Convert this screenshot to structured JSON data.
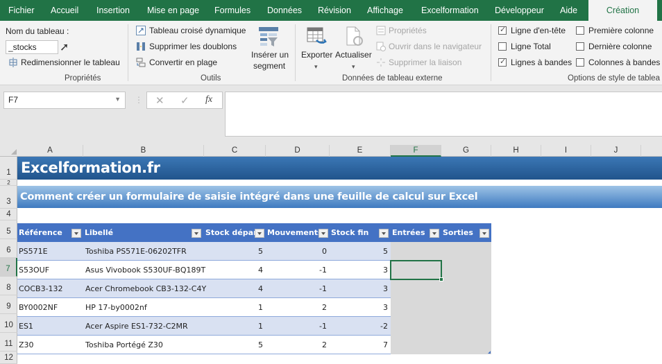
{
  "menu": {
    "tabs": [
      "Fichier",
      "Accueil",
      "Insertion",
      "Mise en page",
      "Formules",
      "Données",
      "Révision",
      "Affichage",
      "Excelformation",
      "Développeur",
      "Aide",
      "Création"
    ],
    "active_tab": "Création"
  },
  "ribbon": {
    "proprietes": {
      "name_label": "Nom du tableau :",
      "name_value": "_stocks",
      "resize_label": "Redimensionner le tableau",
      "group_label": "Propriétés"
    },
    "outils": {
      "pivot_label": "Tableau croisé dynamique",
      "remove_dup_label": "Supprimer les doublons",
      "convert_label": "Convertir en plage",
      "slicer_label_1": "Insérer un",
      "slicer_label_2": "segment",
      "group_label": "Outils"
    },
    "external": {
      "export_label": "Exporter",
      "refresh_label": "Actualiser",
      "properties_label": "Propriétés",
      "open_browser_label": "Ouvrir dans le navigateur",
      "unlink_label": "Supprimer la liaison",
      "group_label": "Données de tableau externe"
    },
    "style_options": {
      "header_row": {
        "label": "Ligne d'en-tête",
        "checked": true
      },
      "total_row": {
        "label": "Ligne Total",
        "checked": false
      },
      "banded_rows": {
        "label": "Lignes à bandes",
        "checked": true
      },
      "first_col": {
        "label": "Première colonne",
        "checked": false
      },
      "last_col": {
        "label": "Dernière colonne",
        "checked": false
      },
      "banded_cols": {
        "label": "Colonnes à bandes",
        "checked": false
      },
      "group_label": "Options de style de tablea"
    }
  },
  "formula_bar": {
    "name_box": "F7",
    "cancel_icon": "✕",
    "enter_icon": "✓",
    "fx_label": "fx",
    "formula": ""
  },
  "grid": {
    "columns": [
      "A",
      "B",
      "C",
      "D",
      "E",
      "F",
      "G",
      "H",
      "I",
      "J"
    ],
    "selected_column": "F",
    "rows": [
      "1",
      "2",
      "3",
      "4",
      "5",
      "6",
      "7",
      "8",
      "9",
      "10",
      "11",
      "12"
    ],
    "selected_row": "7",
    "title": "Excelformation.fr",
    "subtitle": "Comment créer un formulaire de saisie intégré dans une feuille de calcul sur Excel"
  },
  "table": {
    "headers": [
      "Référence",
      "Libellé",
      "Stock départ",
      "Mouvements",
      "Stock fin",
      "Entrées",
      "Sorties"
    ],
    "rows": [
      {
        "ref": "PS571E",
        "label": "Toshiba PS571E-06202TFR",
        "start": "5",
        "moves": "0",
        "end": "5",
        "in": "",
        "out": ""
      },
      {
        "ref": "S53OUF",
        "label": "Asus Vivobook S530UF-BQ189T",
        "start": "4",
        "moves": "-1",
        "end": "3",
        "in": "",
        "out": ""
      },
      {
        "ref": "COCB3-132",
        "label": "Acer Chromebook CB3-132-C4Y",
        "start": "4",
        "moves": "-1",
        "end": "3",
        "in": "",
        "out": ""
      },
      {
        "ref": "BY0002NF",
        "label": "HP 17-by0002nf",
        "start": "1",
        "moves": "2",
        "end": "3",
        "in": "",
        "out": ""
      },
      {
        "ref": "ES1",
        "label": "Acer Aspire ES1-732-C2MR",
        "start": "1",
        "moves": "-1",
        "end": "-2",
        "in": "",
        "out": ""
      },
      {
        "ref": "Z30",
        "label": "Toshiba Portégé Z30",
        "start": "5",
        "moves": "2",
        "end": "7",
        "in": "",
        "out": ""
      }
    ]
  },
  "colors": {
    "accent": "#217346",
    "table_header": "#4472c4",
    "band": "#d9e1f2"
  }
}
